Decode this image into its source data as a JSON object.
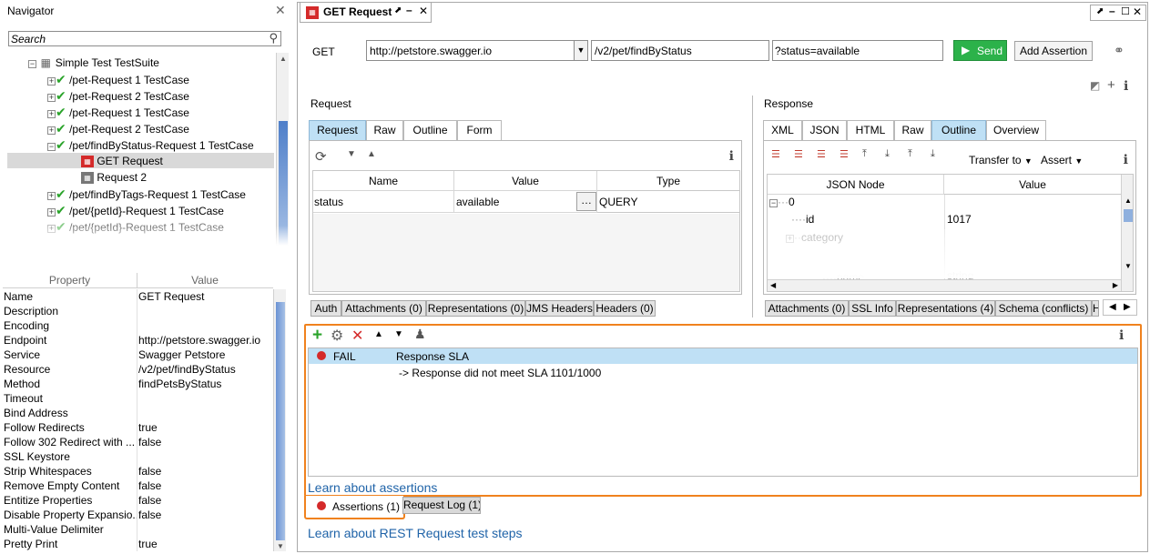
{
  "navigator": {
    "title": "Navigator",
    "search_placeholder": "Search",
    "suite": "Simple Test TestSuite",
    "items": [
      {
        "label": "/pet-Request 1 TestCase"
      },
      {
        "label": "/pet-Request 2 TestCase"
      },
      {
        "label": "/pet-Request 1 TestCase"
      },
      {
        "label": "/pet-Request 2 TestCase"
      },
      {
        "label": "/pet/findByStatus-Request 1 TestCase"
      },
      {
        "label": "GET Request"
      },
      {
        "label": "Request 2"
      },
      {
        "label": "/pet/findByTags-Request 1 TestCase"
      },
      {
        "label": "/pet/{petId}-Request 1 TestCase"
      },
      {
        "label": "/pet/{petId}-Request 1 TestCase"
      }
    ]
  },
  "properties": {
    "header_property": "Property",
    "header_value": "Value",
    "rows": [
      {
        "k": "Name",
        "v": "GET Request"
      },
      {
        "k": "Description",
        "v": ""
      },
      {
        "k": "Encoding",
        "v": ""
      },
      {
        "k": "Endpoint",
        "v": "http://petstore.swagger.io"
      },
      {
        "k": "Service",
        "v": "Swagger Petstore"
      },
      {
        "k": "Resource",
        "v": "/v2/pet/findByStatus"
      },
      {
        "k": "Method",
        "v": "findPetsByStatus"
      },
      {
        "k": "Timeout",
        "v": ""
      },
      {
        "k": "Bind Address",
        "v": ""
      },
      {
        "k": "Follow Redirects",
        "v": "true"
      },
      {
        "k": "Follow 302 Redirect with ...",
        "v": "false"
      },
      {
        "k": "SSL Keystore",
        "v": ""
      },
      {
        "k": "Strip Whitespaces",
        "v": "false"
      },
      {
        "k": "Remove Empty Content",
        "v": "false"
      },
      {
        "k": "Entitize Properties",
        "v": "false"
      },
      {
        "k": "Disable Property Expansio...",
        "v": "false"
      },
      {
        "k": "Multi-Value Delimiter",
        "v": ""
      },
      {
        "k": "Pretty Print",
        "v": "true"
      }
    ]
  },
  "editor": {
    "tab_title": "GET Request",
    "method": "GET",
    "endpoint": "http://petstore.swagger.io",
    "resource": "/v2/pet/findByStatus",
    "params": "?status=available",
    "send": "Send",
    "add_assertion": "Add Assertion"
  },
  "request": {
    "section": "Request",
    "tabs": [
      "Request",
      "Raw",
      "Outline",
      "Form"
    ],
    "table_headers": [
      "Name",
      "Value",
      "Type"
    ],
    "row": {
      "name": "status",
      "value": "available",
      "type": "QUERY"
    },
    "bottom_tabs": [
      "Auth",
      "Attachments (0)",
      "Representations (0)",
      "JMS Headers",
      "Headers (0)"
    ]
  },
  "response": {
    "section": "Response",
    "tabs": [
      "XML",
      "JSON",
      "HTML",
      "Raw",
      "Outline",
      "Overview"
    ],
    "transfer_to": "Transfer to",
    "assert": "Assert",
    "table_headers": [
      "JSON Node",
      "Value"
    ],
    "node0": "0",
    "node_id": "id",
    "node_id_value": "1017",
    "node_category": "category",
    "node_name": "name",
    "node_name_value": "string",
    "bottom_tabs": [
      "Attachments (0)",
      "SSL Info",
      "Representations (4)",
      "Schema (conflicts)",
      "H"
    ]
  },
  "assertions": {
    "status": "FAIL",
    "name": "Response SLA",
    "detail": "-> Response did not meet SLA 1101/1000",
    "learn": "Learn about assertions",
    "tab_assertions": "Assertions (1)",
    "tab_log": "Request Log (1)",
    "learn_rest": "Learn about REST Request test steps"
  },
  "colors": {
    "accent": "#f0821e",
    "send": "#2cb24a",
    "selected": "#bfe0f5",
    "fail": "#d42a2a",
    "link": "#1f63a8"
  }
}
